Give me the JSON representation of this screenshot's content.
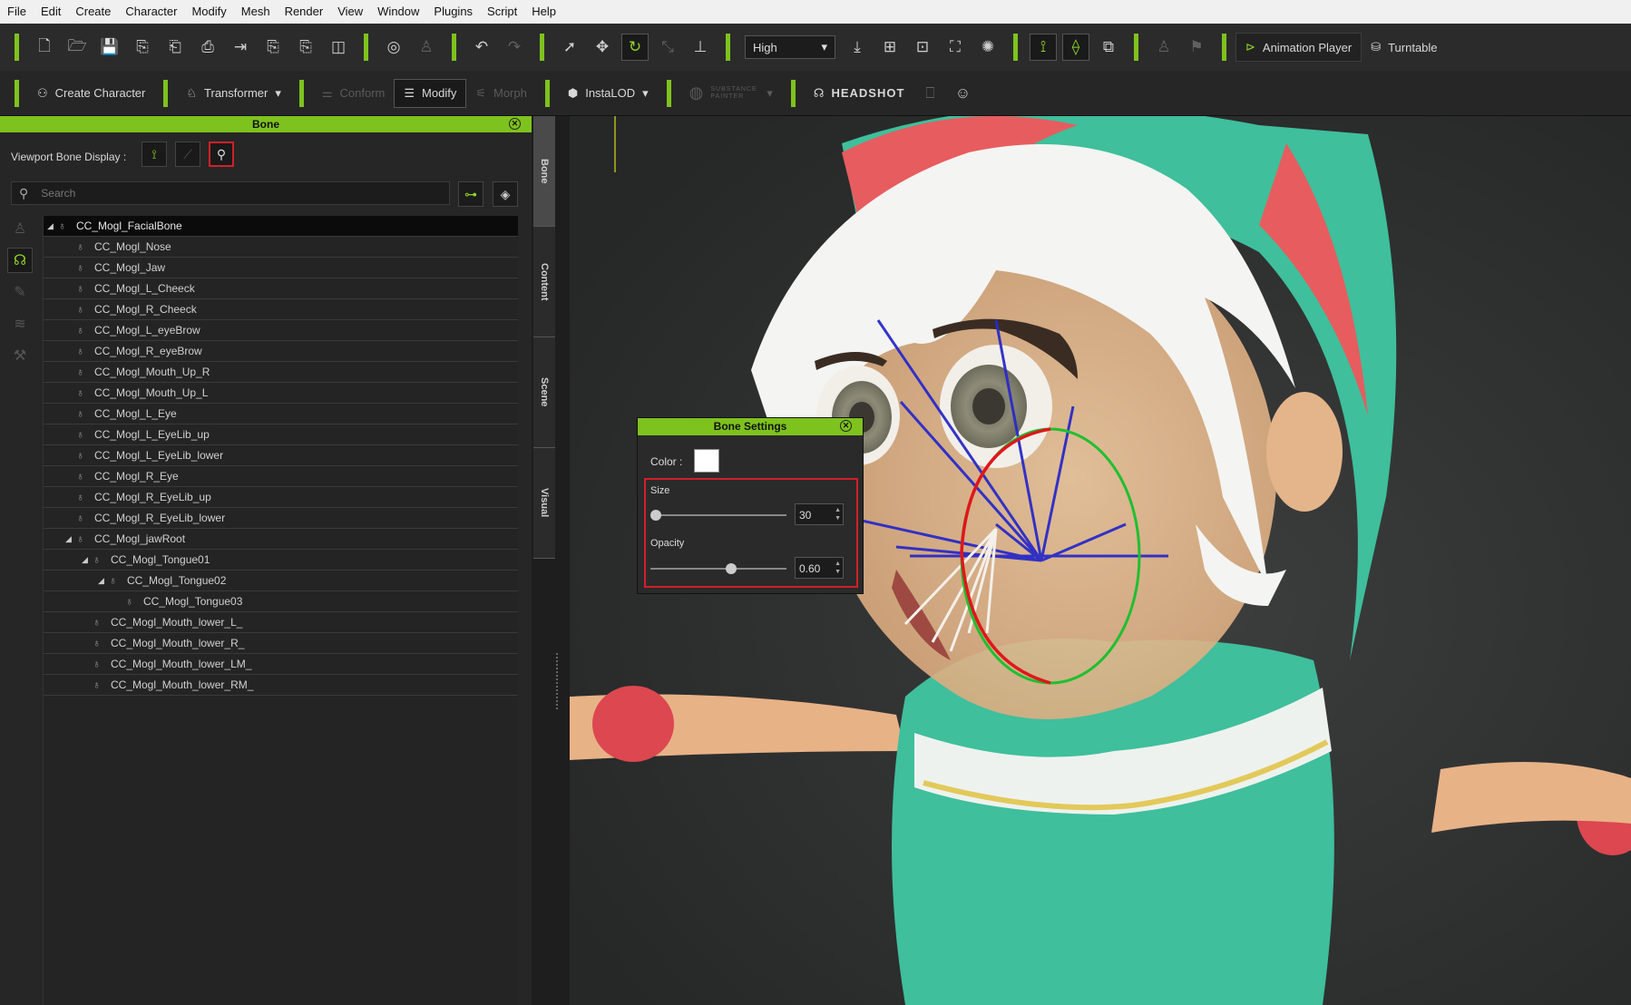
{
  "menu": [
    "File",
    "Edit",
    "Create",
    "Character",
    "Modify",
    "Mesh",
    "Render",
    "View",
    "Window",
    "Plugins",
    "Script",
    "Help"
  ],
  "toolbar": {
    "quality": "High",
    "animation_player": "Animation Player",
    "turntable": "Turntable"
  },
  "toolbar2": {
    "create_character": "Create Character",
    "transformer": "Transformer",
    "conform": "Conform",
    "modify": "Modify",
    "morph": "Morph",
    "instalod": "InstaLOD",
    "headshot": "HEADSHOT"
  },
  "panel": {
    "title": "Bone",
    "viewport_bone_display": "Viewport Bone Display :",
    "search_placeholder": "Search",
    "tabs": [
      "Bone",
      "Content",
      "Scene",
      "Visual"
    ]
  },
  "tree": [
    {
      "label": "CC_Mogl_FacialBone",
      "depth": 0,
      "expand": "open",
      "selected": true
    },
    {
      "label": "CC_Mogl_Nose",
      "depth": 1,
      "expand": "none"
    },
    {
      "label": "CC_Mogl_Jaw",
      "depth": 1,
      "expand": "none"
    },
    {
      "label": "CC_Mogl_L_Cheeck",
      "depth": 1,
      "expand": "none"
    },
    {
      "label": "CC_Mogl_R_Cheeck",
      "depth": 1,
      "expand": "none"
    },
    {
      "label": "CC_Mogl_L_eyeBrow",
      "depth": 1,
      "expand": "none"
    },
    {
      "label": "CC_Mogl_R_eyeBrow",
      "depth": 1,
      "expand": "none"
    },
    {
      "label": "CC_Mogl_Mouth_Up_R",
      "depth": 1,
      "expand": "none"
    },
    {
      "label": "CC_Mogl_Mouth_Up_L",
      "depth": 1,
      "expand": "none"
    },
    {
      "label": "CC_Mogl_L_Eye",
      "depth": 1,
      "expand": "none"
    },
    {
      "label": "CC_Mogl_L_EyeLib_up",
      "depth": 1,
      "expand": "none"
    },
    {
      "label": "CC_Mogl_L_EyeLib_lower",
      "depth": 1,
      "expand": "none"
    },
    {
      "label": "CC_Mogl_R_Eye",
      "depth": 1,
      "expand": "none"
    },
    {
      "label": "CC_Mogl_R_EyeLib_up",
      "depth": 1,
      "expand": "none"
    },
    {
      "label": "CC_Mogl_R_EyeLib_lower",
      "depth": 1,
      "expand": "none"
    },
    {
      "label": "CC_Mogl_jawRoot",
      "depth": 1,
      "expand": "open"
    },
    {
      "label": "CC_Mogl_Tongue01",
      "depth": 2,
      "expand": "open"
    },
    {
      "label": "CC_Mogl_Tongue02",
      "depth": 3,
      "expand": "open"
    },
    {
      "label": "CC_Mogl_Tongue03",
      "depth": 4,
      "expand": "none"
    },
    {
      "label": "CC_Mogl_Mouth_lower_L_",
      "depth": 2,
      "expand": "none"
    },
    {
      "label": "CC_Mogl_Mouth_lower_R_",
      "depth": 2,
      "expand": "none"
    },
    {
      "label": "CC_Mogl_Mouth_lower_LM_",
      "depth": 2,
      "expand": "none"
    },
    {
      "label": "CC_Mogl_Mouth_lower_RM_",
      "depth": 2,
      "expand": "none"
    }
  ],
  "bone_settings": {
    "title": "Bone Settings",
    "color_label": "Color :",
    "color": "#ffffff",
    "size_label": "Size",
    "size_value": "30",
    "size_fraction": 0.0,
    "opacity_label": "Opacity",
    "opacity_value": "0.60",
    "opacity_fraction": 0.6
  },
  "colors": {
    "accent": "#7ec21e",
    "highlight_box": "#d0202a"
  }
}
